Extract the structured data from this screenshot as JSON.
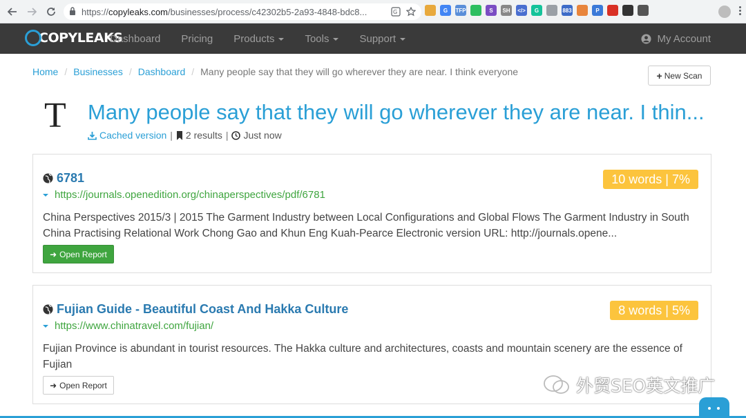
{
  "browser": {
    "url_host": "copyleaks.com",
    "url_path": "/businesses/process/c42302b5-2a93-4848-bdc8...",
    "url_prefix": "https://",
    "extensions": [
      {
        "label": "",
        "color": "#e8a93c",
        "icon": "gear-ext-icon"
      },
      {
        "label": "G",
        "color": "#4285f4",
        "icon": "translate-ext-icon"
      },
      {
        "label": "TFP",
        "color": "#5b8fd9",
        "icon": "tfp-ext-icon"
      },
      {
        "label": "",
        "color": "#2dbe60",
        "icon": "evernote-ext-icon"
      },
      {
        "label": "S",
        "color": "#7b4dc3",
        "icon": "s-ext-icon"
      },
      {
        "label": "SH",
        "color": "#888888",
        "icon": "sh-ext-icon"
      },
      {
        "label": "</>",
        "color": "#4a6fd0",
        "icon": "code-ext-icon"
      },
      {
        "label": "G",
        "color": "#15c39a",
        "icon": "grammarly-ext-icon"
      },
      {
        "label": "",
        "color": "#9aa0a6",
        "icon": "tag-ext-icon"
      },
      {
        "label": "883",
        "color": "#3d6cc8",
        "icon": "counter-ext-icon"
      },
      {
        "label": "",
        "color": "#e8853c",
        "icon": "cookie-ext-icon"
      },
      {
        "label": "P",
        "color": "#3b7ad8",
        "icon": "p-ext-icon"
      },
      {
        "label": "",
        "color": "#d93025",
        "icon": "red-ext-icon"
      },
      {
        "label": "",
        "color": "#333333",
        "icon": "check-ext-icon"
      },
      {
        "label": "",
        "color": "#555555",
        "icon": "mouse-ext-icon"
      }
    ]
  },
  "navbar": {
    "brand": "COPYLEAKS",
    "items": [
      {
        "label": "Dashboard",
        "dropdown": false
      },
      {
        "label": "Pricing",
        "dropdown": false
      },
      {
        "label": "Products",
        "dropdown": true
      },
      {
        "label": "Tools",
        "dropdown": true
      },
      {
        "label": "Support",
        "dropdown": true
      }
    ],
    "account_label": "My Account"
  },
  "breadcrumb": {
    "home": "Home",
    "businesses": "Businesses",
    "dashboard": "Dashboard",
    "current": "Many people say that they will go wherever they are near. I think everyone"
  },
  "new_scan_label": "New Scan",
  "doc_type_letter": "T",
  "page_title": "Many people say that they will go wherever they are near. I thin...",
  "meta": {
    "cached_label": "Cached version",
    "results_label": "2 results",
    "time_label": "Just now"
  },
  "results": [
    {
      "title": "6781",
      "url": "https://journals.openedition.org/chinaperspectives/pdf/6781",
      "badge": "10 words | 7%",
      "snippet": "China Perspectives 2015/3 | 2015 The Garment Industry between Local Configurations and Global Flows The Garment Industry in South China Practising Relational Work Chong Gao and Khun Eng Kuah-Pearce Electronic version URL: http://journals.opene...",
      "button_label": "Open Report"
    },
    {
      "title": "Fujian Guide - Beautiful Coast And Hakka Culture",
      "url": "https://www.chinatravel.com/fujian/",
      "badge": "8 words | 5%",
      "snippet": "Fujian Province is abundant in tourist resources. The Hakka culture and architectures, coasts and mountain scenery are the essence of Fujian",
      "button_label": "Open Report"
    }
  ],
  "watermark": "外贸SEO英文推广",
  "colors": {
    "accent": "#2a9fd6",
    "navbar_bg": "#3a3a3a",
    "badge": "#fcc43d",
    "success": "#3fa53f",
    "link_title": "#2a7ab0"
  }
}
